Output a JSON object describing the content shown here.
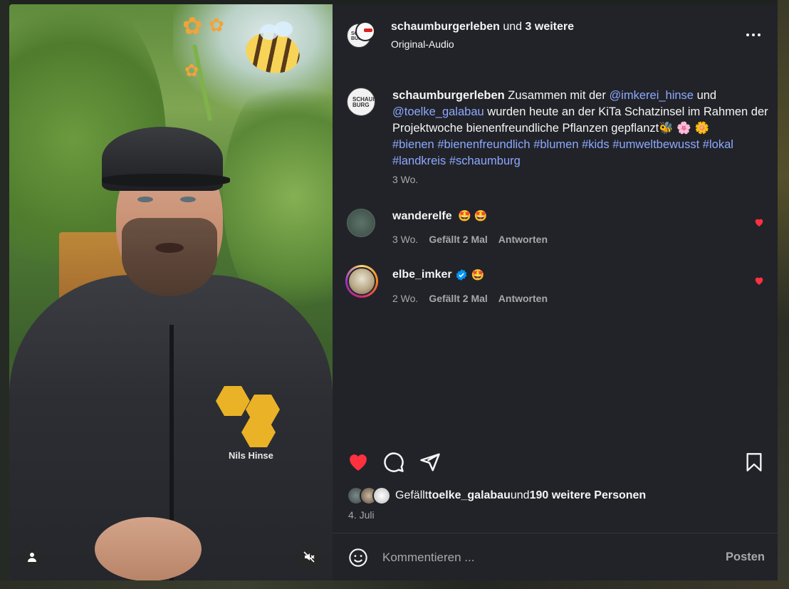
{
  "post": {
    "header": {
      "author": "schaumburgerleben",
      "joiner": " und ",
      "collaborators": "3 weitere",
      "audio": "Original-Audio",
      "author_avatar_text": "SCHAUM BURG"
    },
    "caption": {
      "author": "schaumburgerleben",
      "t1": " Zusammen mit der ",
      "mention1": "@imkerei_hinse",
      "t2": " und ",
      "mention2": "@toelke_galabau",
      "t3": " wurden heute an der KiTa Schatzinsel im Rahmen der Projektwoche bienenfreundliche Pflanzen gepflanzt🐝 🌸 🌼",
      "hashtags": [
        "#bienen",
        "#bienenfreundlich",
        "#blumen",
        "#kids",
        "#umweltbewusst",
        "#lokal",
        "#landkreis",
        "#schaumburg"
      ],
      "time": "3 Wo."
    },
    "comments": [
      {
        "user": "wanderelfe",
        "text": "🤩 🤩",
        "time": "3 Wo.",
        "likes": "Gefällt 2 Mal",
        "reply": "Antworten",
        "verified": false,
        "liked": true
      },
      {
        "user": "elbe_imker",
        "text": "🤩",
        "time": "2 Wo.",
        "likes": "Gefällt 2 Mal",
        "reply": "Antworten",
        "verified": true,
        "liked": true
      }
    ],
    "likes": {
      "prefix": "Gefällt ",
      "user": "toelke_galabau",
      "joiner": " und ",
      "others": "190 weitere Personen"
    },
    "date": "4. Juli",
    "comment_box": {
      "placeholder": "Kommentieren ...",
      "post_label": "Posten"
    },
    "media": {
      "overlay_name": "Nils Hinse"
    }
  },
  "icons": {
    "like": "heart-icon",
    "comment": "comment-icon",
    "share": "send-icon",
    "save": "bookmark-icon",
    "more": "more-icon",
    "emoji": "emoji-icon",
    "user": "user-icon",
    "mute": "volume-mute-icon",
    "verified": "verified-icon"
  },
  "colors": {
    "panel_bg": "#212328",
    "like_red": "#ff3040",
    "link_blue": "#8ea8ff",
    "verified_blue": "#0095f6",
    "muted": "#a8a8a8"
  }
}
